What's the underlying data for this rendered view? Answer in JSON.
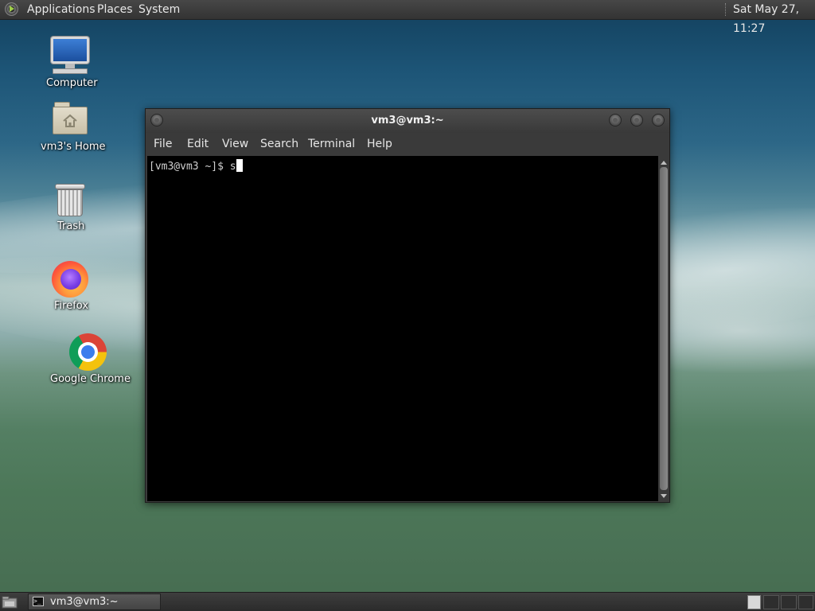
{
  "top_panel": {
    "menus": [
      {
        "label": "Applications"
      },
      {
        "label": "Places"
      },
      {
        "label": "System"
      }
    ],
    "clock": "Sat May 27, 11:27"
  },
  "desktop": {
    "icons": [
      {
        "label": "Computer",
        "icon": "computer-icon"
      },
      {
        "label": "vm3's Home",
        "icon": "home-folder-icon"
      },
      {
        "label": "Trash",
        "icon": "trash-icon"
      },
      {
        "label": "Firefox",
        "icon": "firefox-icon"
      },
      {
        "label": "Google Chrome",
        "icon": "chrome-icon"
      }
    ]
  },
  "terminal": {
    "title": "vm3@vm3:~",
    "menu": [
      {
        "label": "File"
      },
      {
        "label": "Edit"
      },
      {
        "label": "View"
      },
      {
        "label": "Search"
      },
      {
        "label": "Terminal"
      },
      {
        "label": "Help"
      }
    ],
    "prompt": "[vm3@vm3 ~]$ ",
    "input": "s"
  },
  "taskbar": {
    "tasks": [
      {
        "label": "vm3@vm3:~",
        "icon": "terminal-icon"
      }
    ],
    "workspace_count": 4,
    "active_workspace": 1
  },
  "colors": {
    "panel": "#3a3a3a",
    "terminal_bg": "#000000",
    "terminal_fg": "#d0d0d0"
  }
}
